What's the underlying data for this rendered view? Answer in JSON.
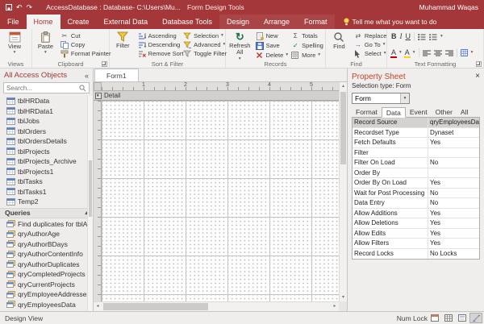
{
  "titlebar": {
    "title": "AccessDatabase : Database- C:\\Users\\Mu...",
    "context": "Form Design Tools",
    "user": "Muhammad Waqas"
  },
  "tabs": {
    "file": "File",
    "items": [
      "Home",
      "Create",
      "External Data",
      "Database Tools",
      "Design",
      "Arrange",
      "Format"
    ],
    "active": "Home",
    "tellme": "Tell me what you want to do"
  },
  "ribbon": {
    "views_group": "Views",
    "view": "View",
    "clipboard_group": "Clipboard",
    "paste": "Paste",
    "cut": "Cut",
    "copy": "Copy",
    "format_painter": "Format Painter",
    "sort_group": "Sort & Filter",
    "filter": "Filter",
    "ascending": "Ascending",
    "descending": "Descending",
    "remove_sort": "Remove Sort",
    "selection": "Selection",
    "advanced": "Advanced",
    "toggle_filter": "Toggle Filter",
    "records_group": "Records",
    "refresh_all": "Refresh All",
    "new": "New",
    "save": "Save",
    "delete": "Delete",
    "totals": "Totals",
    "spelling": "Spelling",
    "more": "More",
    "find_group": "Find",
    "find": "Find",
    "replace": "Replace",
    "go_to": "Go To",
    "select": "Select",
    "text_group": "Text Formatting",
    "bold": "B",
    "italic": "I",
    "underline": "U",
    "font_color": "A",
    "highlight": "A"
  },
  "nav": {
    "title": "All Access Objects",
    "search_placeholder": "Search...",
    "tables": [
      "tblHRData",
      "tblHRData1",
      "tblJobs",
      "tblOrders",
      "tblOrdersDetails",
      "tblProjects",
      "tblProjects_Archive",
      "tblProjects1",
      "tblTasks",
      "tblTasks1",
      "Temp2"
    ],
    "queries_header": "Queries",
    "queries": [
      "Find duplicates for tblAuthors",
      "qryAuthorAge",
      "qryAuthorBDays",
      "qryAuthorContentInfo",
      "qryAuthorDuplicates",
      "qryCompletedProjects",
      "qryCurrentProjects",
      "qryEmployeeAddresses",
      "qryEmployeesData"
    ]
  },
  "form": {
    "tab_label": "Form1",
    "section_label": "Detail",
    "ruler_numbers": [
      "1",
      "2",
      "3",
      "4",
      "5"
    ]
  },
  "props": {
    "title": "Property Sheet",
    "selection_type": "Selection type: Form",
    "selector": "Form",
    "tabs": [
      "Format",
      "Data",
      "Event",
      "Other",
      "All"
    ],
    "active_tab": "Data",
    "rows": [
      {
        "name": "Record Source",
        "value": "qryEmployeesData",
        "selected": true
      },
      {
        "name": "Recordset Type",
        "value": "Dynaset"
      },
      {
        "name": "Fetch Defaults",
        "value": "Yes"
      },
      {
        "name": "Filter",
        "value": ""
      },
      {
        "name": "Filter On Load",
        "value": "No"
      },
      {
        "name": "Order By",
        "value": ""
      },
      {
        "name": "Order By On Load",
        "value": "Yes"
      },
      {
        "name": "Wait for Post Processing",
        "value": "No"
      },
      {
        "name": "Data Entry",
        "value": "No"
      },
      {
        "name": "Allow Additions",
        "value": "Yes"
      },
      {
        "name": "Allow Deletions",
        "value": "Yes"
      },
      {
        "name": "Allow Edits",
        "value": "Yes"
      },
      {
        "name": "Allow Filters",
        "value": "Yes"
      },
      {
        "name": "Record Locks",
        "value": "No Locks"
      }
    ]
  },
  "statusbar": {
    "view_label": "Design View",
    "num_lock": "Num Lock"
  },
  "icons": {
    "caret_down": "▾",
    "close": "×",
    "shutter": "«",
    "expand_up": "▴",
    "scroll_up": "▴",
    "scroll_down": "▾",
    "scroll_left": "◂",
    "scroll_right": "▸",
    "cut": "✂",
    "sigma": "Σ",
    "check": "✓",
    "arrow_right": "→",
    "swap": "⇄",
    "refresh": "↻",
    "undo": "↶",
    "redo": "↷"
  },
  "colors": {
    "accent": "#a4373a",
    "property_title": "#c0462c"
  }
}
